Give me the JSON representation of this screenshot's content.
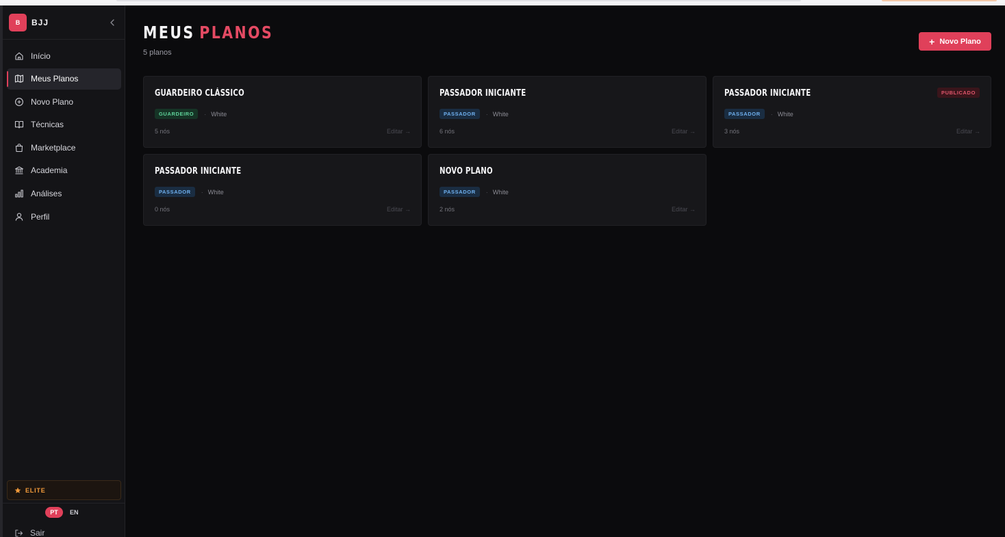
{
  "brand": {
    "logo": "B",
    "name": "BJJ"
  },
  "nav": [
    {
      "label": "Início",
      "icon": "home-icon"
    },
    {
      "label": "Meus Planos",
      "icon": "map-icon",
      "active": true
    },
    {
      "label": "Novo Plano",
      "icon": "plus-circle-icon"
    },
    {
      "label": "Técnicas",
      "icon": "book-icon"
    },
    {
      "label": "Marketplace",
      "icon": "shopping-bag-icon"
    },
    {
      "label": "Academia",
      "icon": "building-icon"
    },
    {
      "label": "Análises",
      "icon": "bar-chart-icon"
    },
    {
      "label": "Perfil",
      "icon": "user-icon"
    }
  ],
  "plan_badge": {
    "label": "ELITE",
    "icon": "star-icon",
    "color": "#f29a3a"
  },
  "language": {
    "active": "PT",
    "other": "EN"
  },
  "logout_label": "Sair",
  "header": {
    "title_word1": "MEUS",
    "title_word2": "PLANOS",
    "subtitle": "5 planos",
    "new_button_label": "Novo Plano"
  },
  "accent_color": "#e0405a",
  "plans": [
    {
      "name": "GUARDEIRO CLÁSSICO",
      "tag": "GUARDEIRO",
      "tag_color": "green",
      "belt": "White",
      "nodes": "5 nós",
      "edit": "Editar →",
      "status": ""
    },
    {
      "name": "PASSADOR INICIANTE",
      "tag": "PASSADOR",
      "tag_color": "blue",
      "belt": "White",
      "nodes": "6 nós",
      "edit": "Editar →",
      "status": ""
    },
    {
      "name": "PASSADOR INICIANTE",
      "tag": "PASSADOR",
      "tag_color": "blue",
      "belt": "White",
      "nodes": "3 nós",
      "edit": "Editar →",
      "status": "PUBLICADO"
    },
    {
      "name": "PASSADOR INICIANTE",
      "tag": "PASSADOR",
      "tag_color": "blue",
      "belt": "White",
      "nodes": "0 nós",
      "edit": "Editar →",
      "status": ""
    },
    {
      "name": "NOVO PLANO",
      "tag": "PASSADOR",
      "tag_color": "blue",
      "belt": "White",
      "nodes": "2 nós",
      "edit": "Editar →",
      "status": ""
    }
  ]
}
